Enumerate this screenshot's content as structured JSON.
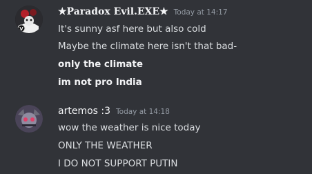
{
  "messages": [
    {
      "author": "★Paradox Evil.EXE★",
      "timestamp": "Today at 14:17",
      "lines": [
        {
          "text": "It's sunny asf here but also cold",
          "bold": false
        },
        {
          "text": "Maybe the climate here isn't that bad-",
          "bold": false
        },
        {
          "text": "only the climate",
          "bold": true
        },
        {
          "text": "im not pro India",
          "bold": true
        }
      ]
    },
    {
      "author": "artemos :3",
      "timestamp": "Today at 14:18",
      "lines": [
        {
          "text": "wow the weather is nice today",
          "bold": false
        },
        {
          "text": "ONLY THE WEATHER",
          "bold": false
        },
        {
          "text": "I DO NOT SUPPORT PUTIN",
          "bold": false
        }
      ]
    }
  ],
  "colors": {
    "background": "#313338",
    "username": "#f2f3f5",
    "text": "#dbdee1",
    "timestamp": "#949ba4"
  }
}
